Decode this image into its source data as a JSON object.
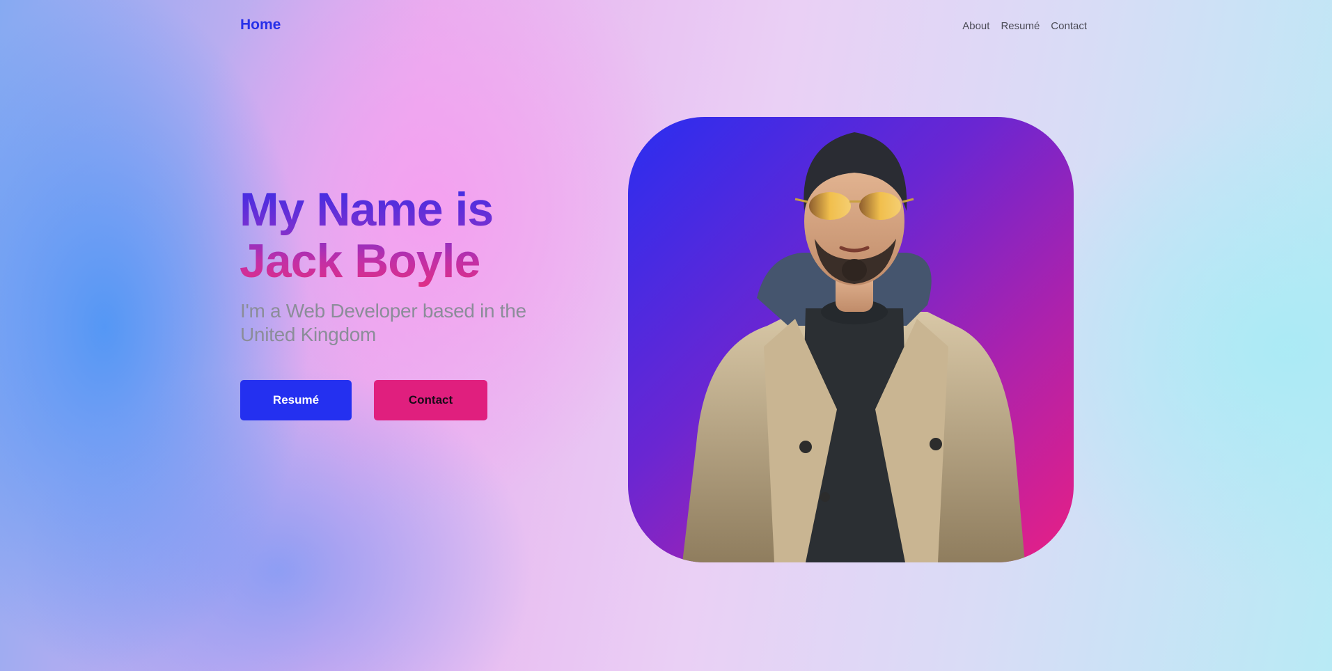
{
  "nav": {
    "home_label": "Home",
    "links": [
      {
        "label": "About"
      },
      {
        "label": "Resumé"
      },
      {
        "label": "Contact"
      }
    ]
  },
  "hero": {
    "title_line1": "My Name is",
    "title_line2": "Jack Boyle",
    "subtitle": "I'm a Web Developer based in the United Kingdom",
    "resume_button": "Resumé",
    "contact_button": "Contact"
  },
  "avatar": {
    "icon": "person-3d-avatar"
  },
  "colors": {
    "primary_blue": "#2430f0",
    "accent_pink": "#e01f7e",
    "nav_home": "#2730e8"
  }
}
